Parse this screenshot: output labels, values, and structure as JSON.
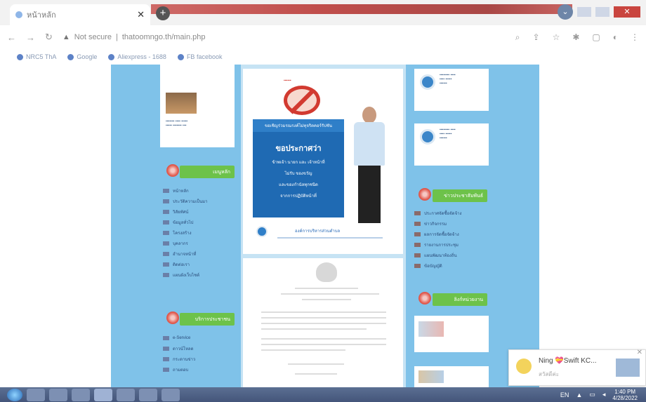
{
  "browser": {
    "tab_title": "หน้าหลัก",
    "url_warning": "Not secure",
    "url": "thatoomngo.th/main.php",
    "bookmarks": [
      "NRC5 ThA",
      "Google",
      "Aliexpress - 1688",
      "FB facebook"
    ]
  },
  "notice": {
    "top_strip": "ขอเชิญร่วมรณรงค์ไม่ทุจริตคอร์รัปชัน",
    "headline": "ขอประกาศว่า",
    "lines": [
      "ข้าพเจ้า นายก และ เจ้าหน้าที่",
      "ไม่รับ ของขวัญ",
      "และของกำนัลทุกชนิด",
      "จากการปฏิบัติหน้าที่"
    ],
    "footer": "องค์การบริหารส่วนตำบล"
  },
  "left_menus": {
    "header1": "เมนูหลัก",
    "items": [
      "หน้าหลัก",
      "ประวัติความเป็นมา",
      "วิสัยทัศน์",
      "ข้อมูลทั่วไป",
      "โครงสร้าง",
      "บุคลากร",
      "อำนาจหน้าที่",
      "ติดต่อเรา",
      "แผนผังเว็บไซต์"
    ],
    "header2": "บริการประชาชน",
    "items2": [
      "e-Service",
      "ดาวน์โหลด",
      "กระดานข่าว",
      "ถามตอบ"
    ]
  },
  "right_menus": {
    "header1": "ข่าวประชาสัมพันธ์",
    "items": [
      "ประกาศจัดซื้อจัดจ้าง",
      "ข่าวกิจกรรม",
      "ผลการจัดซื้อจัดจ้าง",
      "รายงานการประชุม",
      "แผนพัฒนาท้องถิ่น",
      "ข้อบัญญัติ"
    ],
    "header2": "ลิงก์หน่วยงาน"
  },
  "toast": {
    "name": "Ning 💝Swift KC...",
    "message": "สวัสดีค่ะ"
  },
  "taskbar": {
    "lang": "EN",
    "time": "1:40 PM",
    "date": "4/28/2022"
  }
}
